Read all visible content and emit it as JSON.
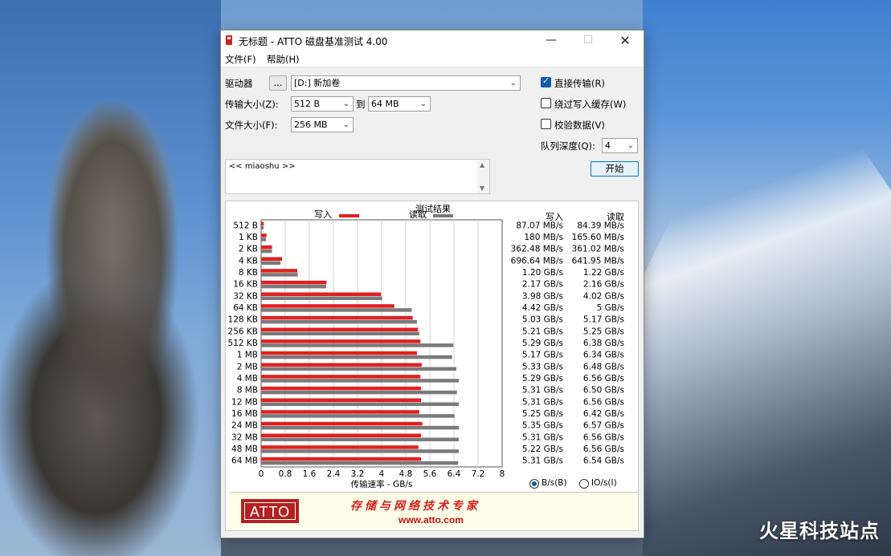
{
  "window": {
    "title": "无标题 - ATTO 磁盘基准测试 4.00"
  },
  "menu": [
    "文件(F)",
    "帮助(H)"
  ],
  "controls": {
    "drive_label": "驱动器",
    "browse_label": "...",
    "drive_value": "[D:] 新加卷",
    "transfer_label": "传输大小(Z):",
    "transfer_from": "512 B",
    "to_label": "到",
    "transfer_to": "64 MB",
    "file_size_label": "文件大小(F):",
    "file_size": "256 MB",
    "direct_io": {
      "label": "直接传输(R)",
      "checked": true
    },
    "bypass_cache": {
      "label": "绕过写入缓存(W)",
      "checked": false
    },
    "verify": {
      "label": "校验数据(V)",
      "checked": false
    },
    "queue_label": "队列深度(Q):",
    "queue_value": "4",
    "start_label": "开始"
  },
  "description": "<< miaoshu >>",
  "results": {
    "header": "测试结果",
    "legend_write": "写入",
    "legend_read": "读取",
    "col_write": "写入",
    "col_read": "读取",
    "unit_bytes": "B/s(B)",
    "unit_io": "IO/s(I)",
    "rows": [
      {
        "w": "87.07 MB/s",
        "r": "84.39 MB/s"
      },
      {
        "w": "180 MB/s",
        "r": "165.60 MB/s"
      },
      {
        "w": "362.48 MB/s",
        "r": "361.02 MB/s"
      },
      {
        "w": "696.64 MB/s",
        "r": "641.95 MB/s"
      },
      {
        "w": "1.20 GB/s",
        "r": "1.22 GB/s"
      },
      {
        "w": "2.17 GB/s",
        "r": "2.16 GB/s"
      },
      {
        "w": "3.98 GB/s",
        "r": "4.02 GB/s"
      },
      {
        "w": "4.42 GB/s",
        "r": "5 GB/s"
      },
      {
        "w": "5.03 GB/s",
        "r": "5.17 GB/s"
      },
      {
        "w": "5.21 GB/s",
        "r": "5.25 GB/s"
      },
      {
        "w": "5.29 GB/s",
        "r": "6.38 GB/s"
      },
      {
        "w": "5.17 GB/s",
        "r": "6.34 GB/s"
      },
      {
        "w": "5.33 GB/s",
        "r": "6.48 GB/s"
      },
      {
        "w": "5.29 GB/s",
        "r": "6.56 GB/s"
      },
      {
        "w": "5.31 GB/s",
        "r": "6.50 GB/s"
      },
      {
        "w": "5.31 GB/s",
        "r": "6.56 GB/s"
      },
      {
        "w": "5.25 GB/s",
        "r": "6.42 GB/s"
      },
      {
        "w": "5.35 GB/s",
        "r": "6.57 GB/s"
      },
      {
        "w": "5.31 GB/s",
        "r": "6.56 GB/s"
      },
      {
        "w": "5.22 GB/s",
        "r": "6.56 GB/s"
      },
      {
        "w": "5.31 GB/s",
        "r": "6.54 GB/s"
      }
    ]
  },
  "chart_data": {
    "type": "bar",
    "orientation": "horizontal",
    "categories": [
      "512 B",
      "1 KB",
      "2 KB",
      "4 KB",
      "8 KB",
      "16 KB",
      "32 KB",
      "64 KB",
      "128 KB",
      "256 KB",
      "512 KB",
      "1 MB",
      "2 MB",
      "4 MB",
      "8 MB",
      "12 MB",
      "16 MB",
      "24 MB",
      "32 MB",
      "48 MB",
      "64 MB"
    ],
    "series": [
      {
        "name": "写入",
        "color": "#e02020",
        "values": [
          0.08707,
          0.18,
          0.36248,
          0.69664,
          1.2,
          2.17,
          3.98,
          4.42,
          5.03,
          5.21,
          5.29,
          5.17,
          5.33,
          5.29,
          5.31,
          5.31,
          5.25,
          5.35,
          5.31,
          5.22,
          5.31
        ]
      },
      {
        "name": "读取",
        "color": "#7a7a7a",
        "values": [
          0.08439,
          0.1656,
          0.36102,
          0.64195,
          1.22,
          2.16,
          4.02,
          5.0,
          5.17,
          5.25,
          6.38,
          6.34,
          6.48,
          6.56,
          6.5,
          6.56,
          6.42,
          6.57,
          6.56,
          6.56,
          6.54
        ]
      }
    ],
    "xlabel": "传输速率 - GB/s",
    "xlim": [
      0,
      8
    ],
    "xticks": [
      "0",
      "0.8",
      "1.6",
      "2.4",
      "3.2",
      "4",
      "4.8",
      "5.6",
      "6.4",
      "7.2",
      "8"
    ],
    "grid": true
  },
  "banner": {
    "logo": "ATTO",
    "slogan": "存储与网络技术专家",
    "url": "www.atto.com"
  },
  "watermark": "火星科技站点"
}
